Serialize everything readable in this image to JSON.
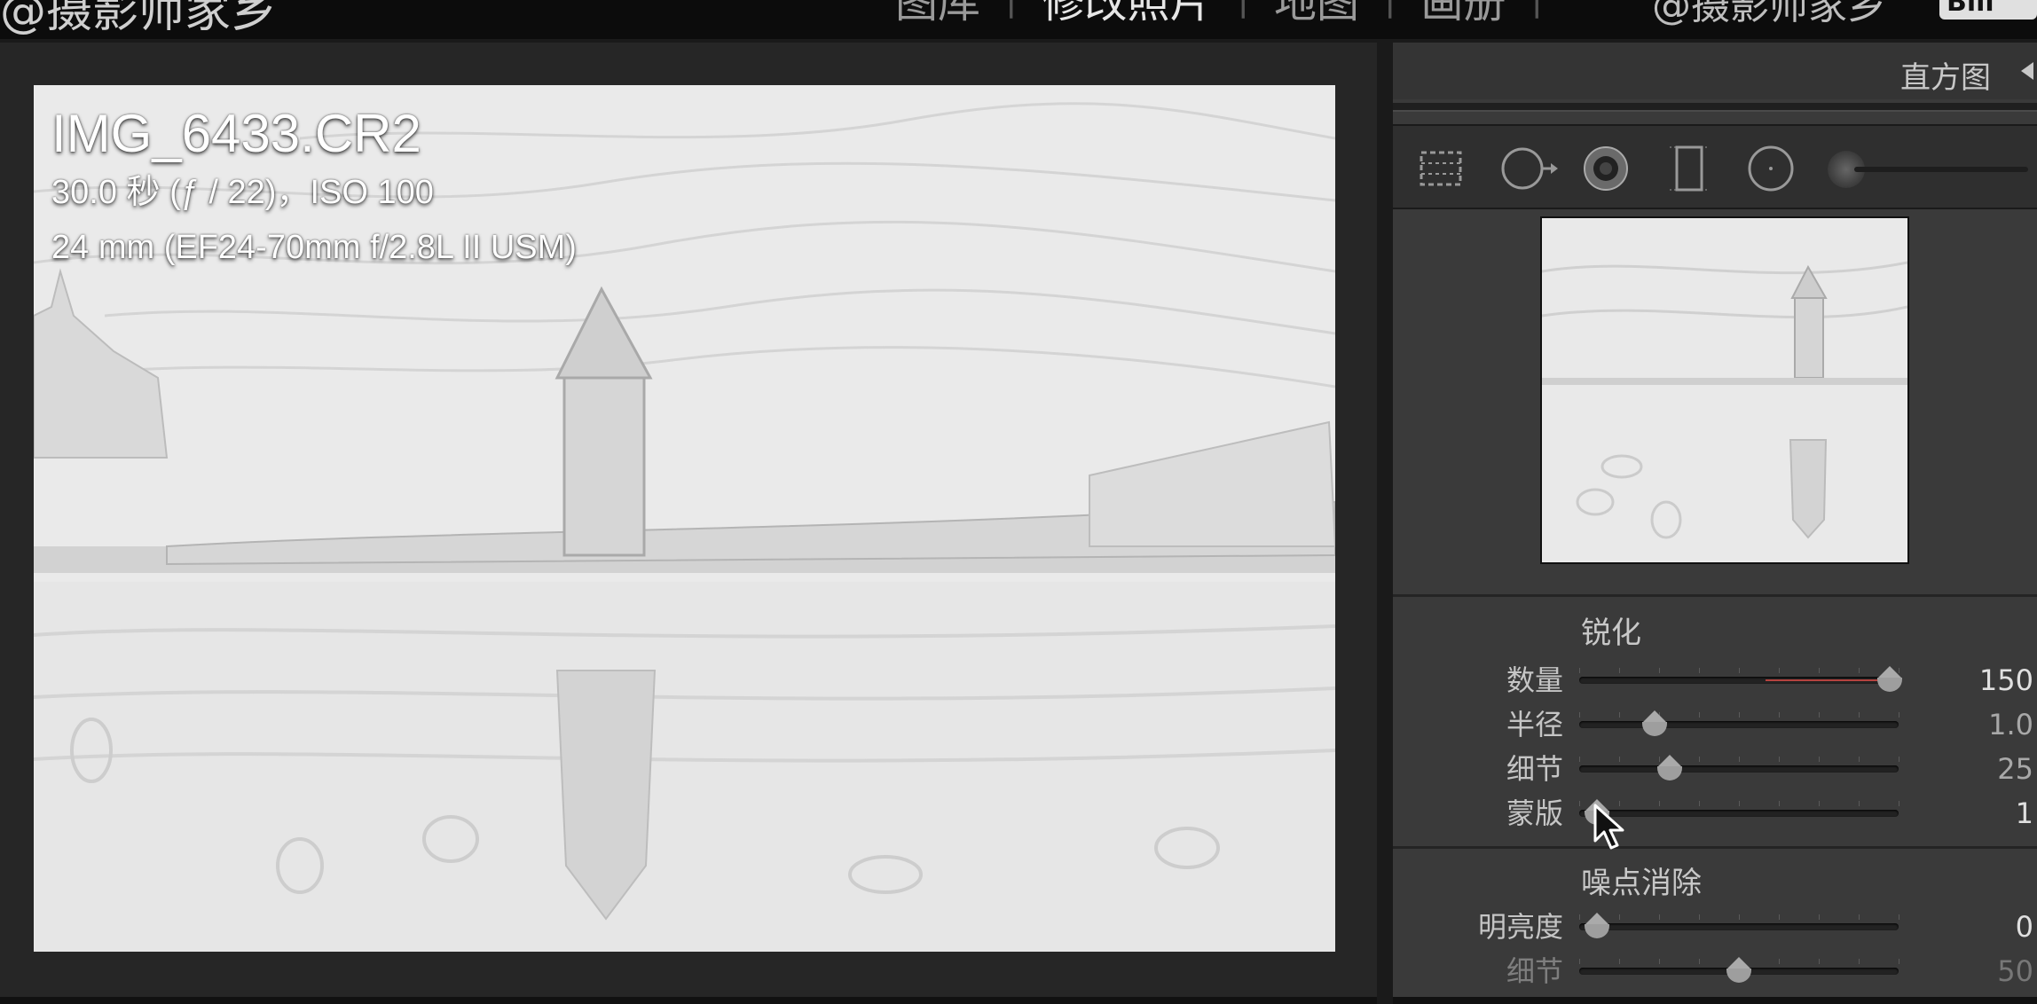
{
  "topbar": {
    "brand": "@摄影师家乡",
    "modules": [
      {
        "label": "图库",
        "active": false
      },
      {
        "label": "修改照片",
        "active": true
      },
      {
        "label": "地图",
        "active": false
      },
      {
        "label": "画册",
        "active": false
      }
    ],
    "identity": "@摄影师家乡",
    "badge": "Bili"
  },
  "photo": {
    "filename": "IMG_6433.CR2",
    "exposure": "30.0 秒 (ƒ / 22)，ISO 100",
    "lens": "24 mm (EF24-70mm f/2.8L II USM)"
  },
  "panel": {
    "histogram_title": "直方图",
    "sharpen": {
      "title": "锐化",
      "sliders": [
        {
          "label": "数量",
          "value": "150",
          "position": 1.0
        },
        {
          "label": "半径",
          "value": "1.0",
          "position": 0.22
        },
        {
          "label": "细节",
          "value": "25",
          "position": 0.27
        },
        {
          "label": "蒙版",
          "value": "1",
          "position": 0.03
        }
      ]
    },
    "noise": {
      "title": "噪点消除",
      "sliders": [
        {
          "label": "明亮度",
          "value": "0",
          "position": 0.03
        },
        {
          "label": "细节",
          "value": "50",
          "position": 0.5
        }
      ]
    }
  },
  "colors": {
    "accent_red": "#b5433f",
    "panel_bg": "#3a3a3a",
    "topbar_bg": "#0c0c0c"
  }
}
